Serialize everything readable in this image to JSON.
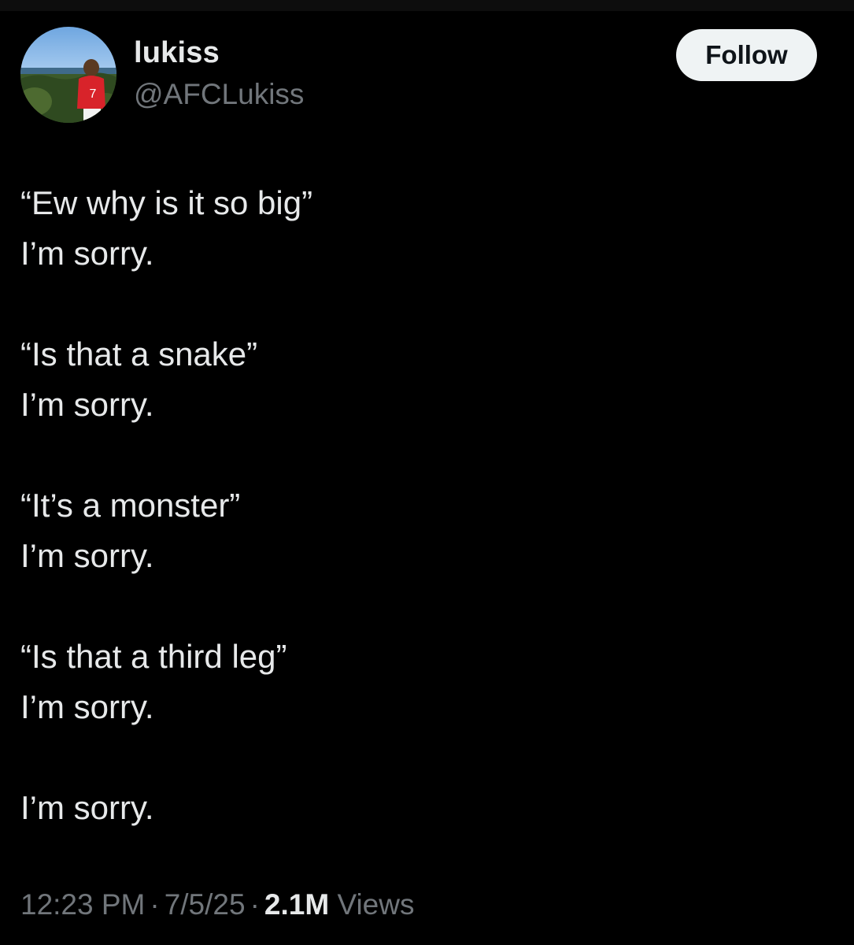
{
  "author": {
    "display_name": "lukiss",
    "handle": "@AFCLukiss",
    "avatar": {
      "icon": "profile-photo-avatar",
      "jersey_number": "7"
    }
  },
  "follow_button": {
    "label": "Follow"
  },
  "tweet": {
    "lines": [
      "“Ew why is it so big”",
      "I’m sorry.",
      "“Is that a snake”",
      "I’m sorry.",
      "“It’s a monster”",
      "I’m sorry.",
      "“Is that a third leg”",
      "I’m sorry.",
      "I’m sorry."
    ]
  },
  "meta": {
    "time": "12:23 PM",
    "separator": "·",
    "date": "7/5/25",
    "views_count": "2.1M",
    "views_label": "Views"
  },
  "colors": {
    "background": "#000000",
    "text_primary": "#e7e9ea",
    "text_secondary": "#71767b",
    "button_bg": "#eff3f4",
    "button_text": "#0f1419"
  }
}
